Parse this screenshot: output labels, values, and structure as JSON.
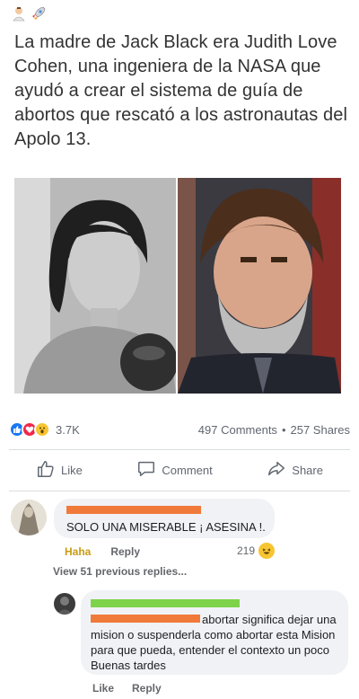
{
  "post": {
    "emoji_icons": [
      "scientist-emoji-icon",
      "rocket-emoji-icon"
    ],
    "text": "La madre de Jack Black era Judith Love Cohen, una ingeniera de la NASA que ayudó a crear el sistema de guía de abortos que rescató a los astronautas del Apolo 13."
  },
  "stats": {
    "reaction_icons": [
      "like-reaction-icon",
      "love-reaction-icon",
      "wow-reaction-icon"
    ],
    "reaction_count": "3.7K",
    "comments": "497 Comments",
    "separator": "•",
    "shares": "257 Shares"
  },
  "actions": {
    "like": "Like",
    "comment": "Comment",
    "share": "Share"
  },
  "comment1": {
    "text": "SOLO UNA MISERABLE ¡ ASESINA !.",
    "haha": "Haha",
    "reply": "Reply",
    "reaction_count": "219"
  },
  "view_previous": "View 51 previous replies...",
  "comment2": {
    "text": "abortar significa dejar una mision o suspenderla como abortar esta Mision para que pueda, entender el contexto un poco Buenas tardes",
    "like": "Like",
    "reply": "Reply"
  },
  "colors": {
    "redact_orange": "#f07a3a",
    "redact_green": "#7ed34b",
    "facebook_blue": "#1877f2"
  }
}
